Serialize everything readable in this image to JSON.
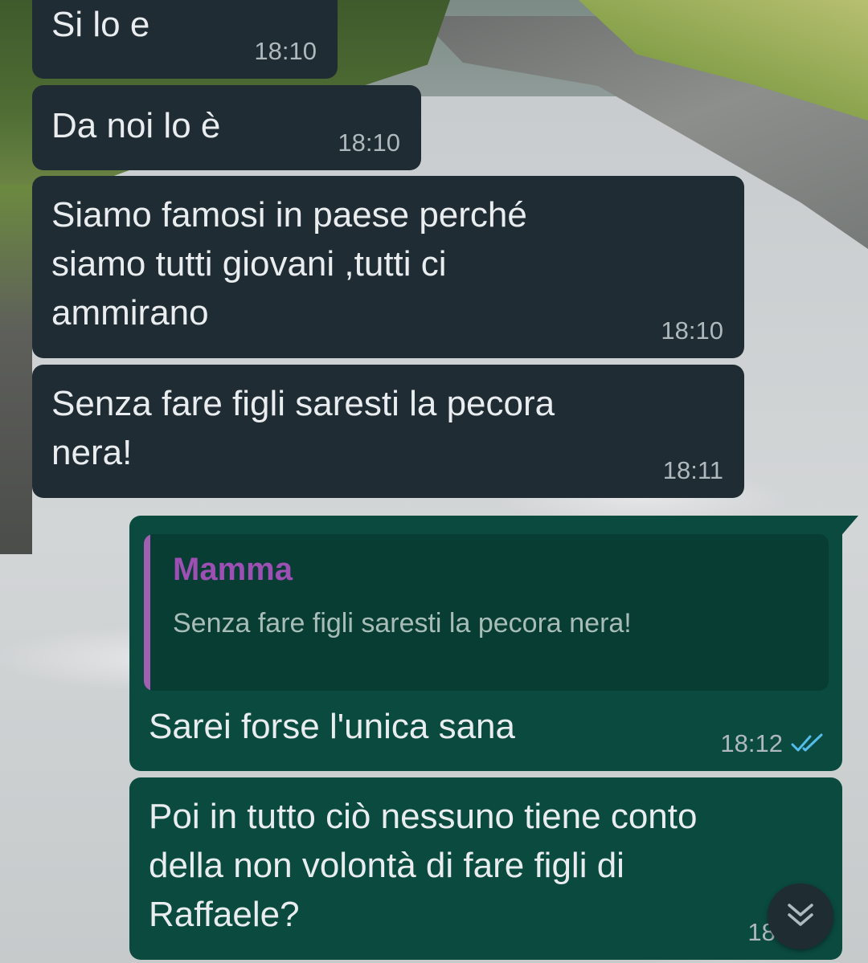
{
  "messages": [
    {
      "id": "msg1",
      "direction": "incoming",
      "text": "Si lo e",
      "time": "18:10"
    },
    {
      "id": "msg2",
      "direction": "incoming",
      "text": "Da noi lo è",
      "time": "18:10"
    },
    {
      "id": "msg3",
      "direction": "incoming",
      "text": "Siamo famosi in paese perché\nsiamo tutti giovani ,tutti ci\nammirano",
      "time": "18:10"
    },
    {
      "id": "msg4",
      "direction": "incoming",
      "text": "Senza fare figli saresti la pecora\nnera!",
      "time": "18:11"
    },
    {
      "id": "msg5",
      "direction": "outgoing",
      "quoted": {
        "author": "Mamma",
        "text": "Senza fare figli saresti la pecora\nnera!"
      },
      "text": "Sarei forse l'unica sana",
      "time": "18:12",
      "status_icon": "double-check-read-icon"
    },
    {
      "id": "msg6",
      "direction": "outgoing",
      "text": "Poi in tutto ciò nessuno tiene conto\ndella non volontà di fare figli di\nRaffaele?",
      "time": "18:13"
    }
  ],
  "controls": {
    "scroll_down_icon": "double-chevron-down-icon"
  },
  "colors": {
    "incoming_bubble": "#202c33",
    "outgoing_bubble": "#0b4a3f",
    "quote_bar": "#a05fb0",
    "quote_author": "#9d4fb4",
    "read_ticks": "#53bdeb",
    "text": "#e9edef",
    "time": "#aeb8bd"
  }
}
